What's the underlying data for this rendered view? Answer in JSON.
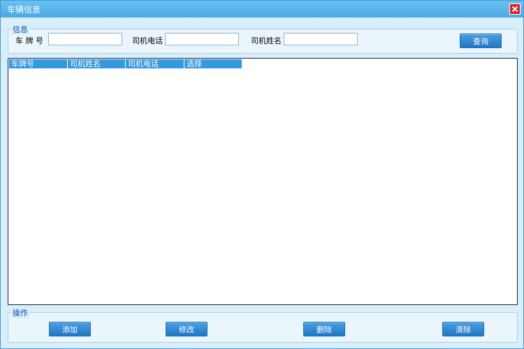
{
  "window": {
    "title": "车辆信息"
  },
  "info_group": {
    "legend": "信息",
    "plate_label": "车 牌 号",
    "plate_value": "",
    "phone_label": "司机电话",
    "phone_value": "",
    "name_label": "司机姓名",
    "name_value": "",
    "query_label": "查询"
  },
  "table": {
    "columns": [
      "车牌号",
      "司机姓名",
      "司机电话",
      "选择"
    ],
    "rows": []
  },
  "ops_group": {
    "legend": "操作",
    "add_label": "添加",
    "edit_label": "修改",
    "delete_label": "删除",
    "clear_label": "清除"
  },
  "colors": {
    "accent": "#3399e0",
    "close": "#d9231a"
  },
  "icons": {
    "close": "close-icon"
  }
}
